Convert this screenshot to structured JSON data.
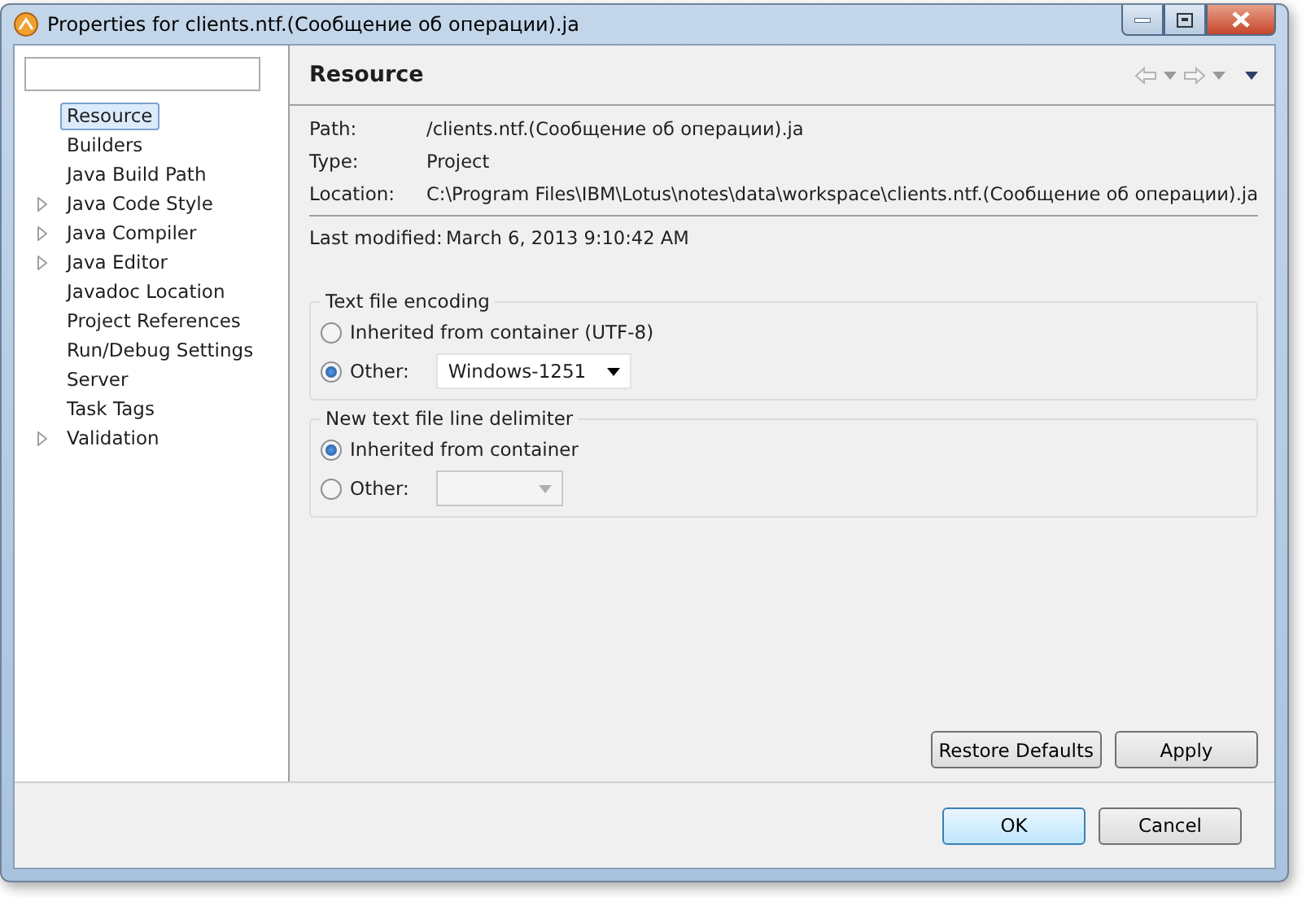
{
  "window": {
    "title": "Properties for clients.ntf.(Сообщение об операции).ja"
  },
  "tree": [
    {
      "label": "Resource",
      "expandable": false,
      "selected": true
    },
    {
      "label": "Builders",
      "expandable": false,
      "selected": false
    },
    {
      "label": "Java Build Path",
      "expandable": false,
      "selected": false
    },
    {
      "label": "Java Code Style",
      "expandable": true,
      "selected": false
    },
    {
      "label": "Java Compiler",
      "expandable": true,
      "selected": false
    },
    {
      "label": "Java Editor",
      "expandable": true,
      "selected": false
    },
    {
      "label": "Javadoc Location",
      "expandable": false,
      "selected": false
    },
    {
      "label": "Project References",
      "expandable": false,
      "selected": false
    },
    {
      "label": "Run/Debug Settings",
      "expandable": false,
      "selected": false
    },
    {
      "label": "Server",
      "expandable": false,
      "selected": false
    },
    {
      "label": "Task Tags",
      "expandable": false,
      "selected": false
    },
    {
      "label": "Validation",
      "expandable": true,
      "selected": false
    }
  ],
  "page": {
    "title": "Resource",
    "info": [
      {
        "label": "Path:",
        "value": "/clients.ntf.(Сообщение об операции).ja"
      },
      {
        "label": "Type:",
        "value": "Project"
      },
      {
        "label": "Location:",
        "value": "C:\\Program Files\\IBM\\Lotus\\notes\\data\\workspace\\clients.ntf.(Сообщение об операции).ja"
      }
    ],
    "modified": {
      "label": "Last modified:",
      "value": "March 6, 2013 9:10:42 AM"
    },
    "groups": [
      {
        "title": "Text file encoding",
        "options": [
          {
            "label": "Inherited from container (UTF-8)",
            "selected": false
          },
          {
            "label": "Other:",
            "selected": true,
            "kind": "combo",
            "combo": "Windows-1251",
            "disabled": false
          }
        ]
      },
      {
        "title": "New text file line delimiter",
        "options": [
          {
            "label": "Inherited from container",
            "selected": true
          },
          {
            "label": "Other:",
            "selected": false,
            "kind": "combo",
            "disabled": true
          }
        ]
      }
    ],
    "page_buttons": [
      "Restore Defaults",
      "Apply"
    ]
  },
  "buttons": [
    {
      "label": "OK",
      "default": true
    },
    {
      "label": "Cancel",
      "default": false
    }
  ]
}
